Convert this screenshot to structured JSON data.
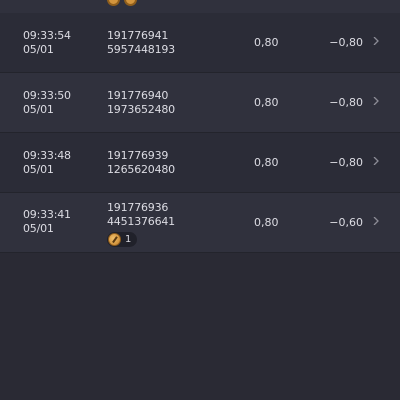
{
  "rows": [
    {
      "time": "09:33:54",
      "date": "05/01",
      "id": "191776941",
      "ref": "5957448193",
      "qty": "0,80",
      "pnl": "−0,80"
    },
    {
      "time": "09:33:50",
      "date": "05/01",
      "id": "191776940",
      "ref": "1973652480",
      "qty": "0,80",
      "pnl": "−0,80"
    },
    {
      "time": "09:33:48",
      "date": "05/01",
      "id": "191776939",
      "ref": "1265620480",
      "qty": "0,80",
      "pnl": "−0,80"
    },
    {
      "time": "09:33:41",
      "date": "05/01",
      "id": "191776936",
      "ref": "4451376641",
      "qty": "0,80",
      "pnl": "−0,60",
      "badge": {
        "icon": "coin-icon",
        "count": "1"
      }
    }
  ],
  "colors": {
    "background": "#2a2a34",
    "row_alt": "#30313d",
    "row_base": "#2b2c37",
    "text": "#dcdce3",
    "coin": "#d3953d"
  }
}
